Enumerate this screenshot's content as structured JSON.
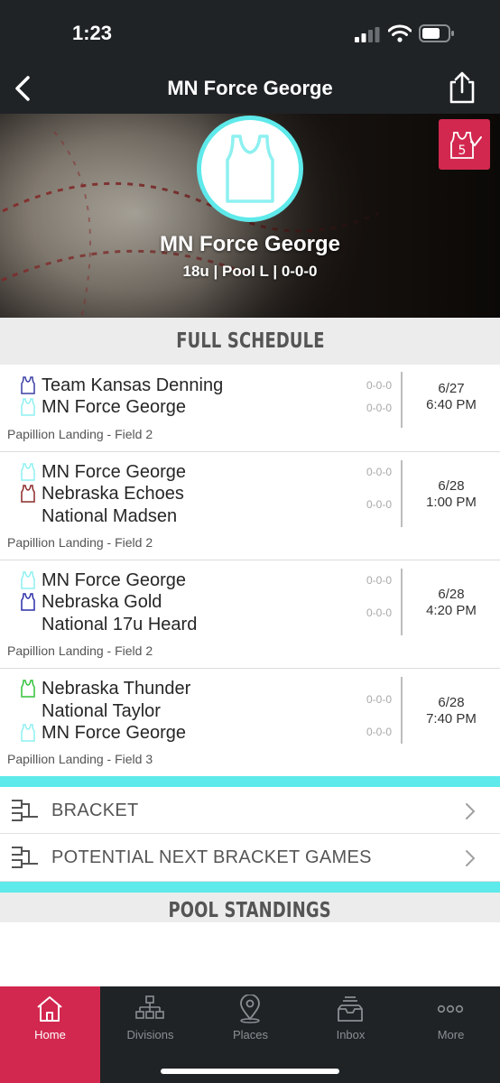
{
  "status_bar": {
    "time": "1:23"
  },
  "nav": {
    "title": "MN Force George",
    "back_icon": "chevron-left-icon",
    "share_icon": "share-icon"
  },
  "team": {
    "name": "MN Force George",
    "subtitle": "18u | Pool L | 0-0-0",
    "logo_icon": "jersey-icon",
    "logo_color": "#5ee9ea",
    "badge_icon": "favorite-team-badge-icon",
    "badge_color": "#d2284f"
  },
  "schedule": {
    "heading": "FULL SCHEDULE",
    "games": [
      {
        "teams": [
          {
            "name": "Team Kansas Denning",
            "color": "#3a3fa6",
            "record": "0-0-0"
          },
          {
            "name": "MN Force George",
            "color": "#8ef0f0",
            "record": "0-0-0"
          }
        ],
        "date": "6/27",
        "time": "6:40 PM",
        "venue": "Papillion Landing - Field 2"
      },
      {
        "teams": [
          {
            "name": "MN Force George",
            "color": "#8ef0f0",
            "record": "0-0-0"
          },
          {
            "name": "Nebraska Echoes",
            "extra": "National Madsen",
            "color": "#8b2a2a",
            "record": "0-0-0"
          }
        ],
        "date": "6/28",
        "time": "1:00 PM",
        "venue": "Papillion Landing - Field 2"
      },
      {
        "teams": [
          {
            "name": "MN Force George",
            "color": "#8ef0f0",
            "record": "0-0-0"
          },
          {
            "name": "Nebraska Gold",
            "extra": "National 17u Heard",
            "color": "#2b2fa8",
            "record": "0-0-0"
          }
        ],
        "date": "6/28",
        "time": "4:20 PM",
        "venue": "Papillion Landing - Field 2"
      },
      {
        "teams": [
          {
            "name": "Nebraska Thunder",
            "extra": "National Taylor",
            "color": "#33c23a",
            "record": "0-0-0"
          },
          {
            "name": "MN Force George",
            "color": "#8ef0f0",
            "record": "0-0-0"
          }
        ],
        "date": "6/28",
        "time": "7:40 PM",
        "venue": "Papillion Landing - Field 3"
      }
    ]
  },
  "links": {
    "bracket": "BRACKET",
    "potential_next": "POTENTIAL NEXT BRACKET GAMES"
  },
  "pool_standings": {
    "heading": "POOL STANDINGS"
  },
  "tabbar": {
    "home": "Home",
    "divisions": "Divisions",
    "places": "Places",
    "inbox": "Inbox",
    "more": "More"
  },
  "colors": {
    "accent": "#d2284f",
    "cyan": "#5ee9ea",
    "dark": "#1f2326"
  }
}
